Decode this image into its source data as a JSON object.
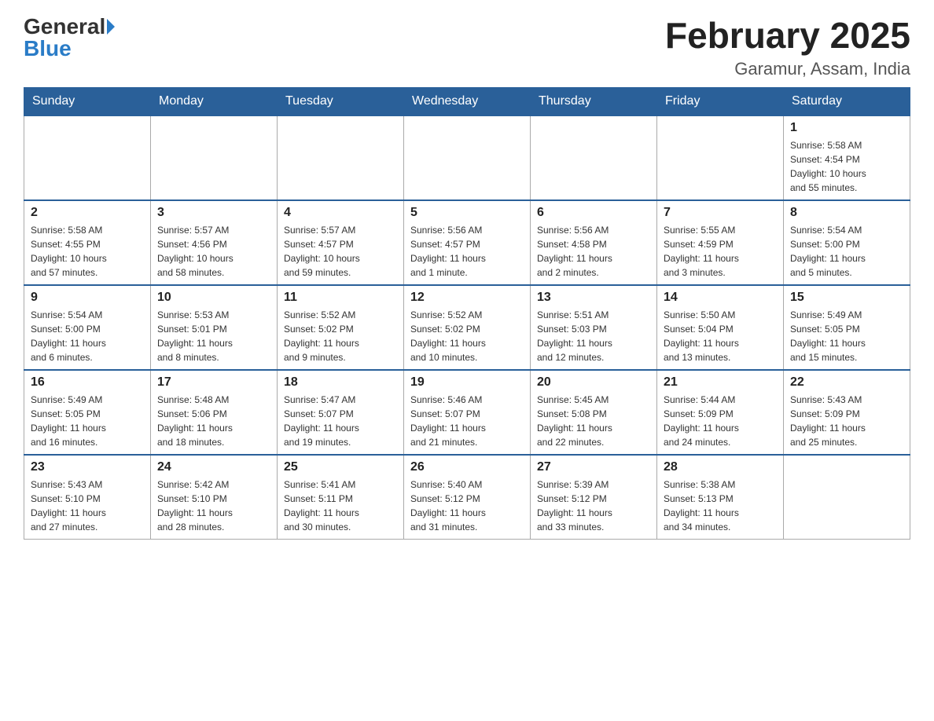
{
  "header": {
    "logo_general": "General",
    "logo_blue": "Blue",
    "title": "February 2025",
    "subtitle": "Garamur, Assam, India"
  },
  "weekdays": [
    "Sunday",
    "Monday",
    "Tuesday",
    "Wednesday",
    "Thursday",
    "Friday",
    "Saturday"
  ],
  "weeks": [
    [
      {
        "day": "",
        "info": ""
      },
      {
        "day": "",
        "info": ""
      },
      {
        "day": "",
        "info": ""
      },
      {
        "day": "",
        "info": ""
      },
      {
        "day": "",
        "info": ""
      },
      {
        "day": "",
        "info": ""
      },
      {
        "day": "1",
        "info": "Sunrise: 5:58 AM\nSunset: 4:54 PM\nDaylight: 10 hours\nand 55 minutes."
      }
    ],
    [
      {
        "day": "2",
        "info": "Sunrise: 5:58 AM\nSunset: 4:55 PM\nDaylight: 10 hours\nand 57 minutes."
      },
      {
        "day": "3",
        "info": "Sunrise: 5:57 AM\nSunset: 4:56 PM\nDaylight: 10 hours\nand 58 minutes."
      },
      {
        "day": "4",
        "info": "Sunrise: 5:57 AM\nSunset: 4:57 PM\nDaylight: 10 hours\nand 59 minutes."
      },
      {
        "day": "5",
        "info": "Sunrise: 5:56 AM\nSunset: 4:57 PM\nDaylight: 11 hours\nand 1 minute."
      },
      {
        "day": "6",
        "info": "Sunrise: 5:56 AM\nSunset: 4:58 PM\nDaylight: 11 hours\nand 2 minutes."
      },
      {
        "day": "7",
        "info": "Sunrise: 5:55 AM\nSunset: 4:59 PM\nDaylight: 11 hours\nand 3 minutes."
      },
      {
        "day": "8",
        "info": "Sunrise: 5:54 AM\nSunset: 5:00 PM\nDaylight: 11 hours\nand 5 minutes."
      }
    ],
    [
      {
        "day": "9",
        "info": "Sunrise: 5:54 AM\nSunset: 5:00 PM\nDaylight: 11 hours\nand 6 minutes."
      },
      {
        "day": "10",
        "info": "Sunrise: 5:53 AM\nSunset: 5:01 PM\nDaylight: 11 hours\nand 8 minutes."
      },
      {
        "day": "11",
        "info": "Sunrise: 5:52 AM\nSunset: 5:02 PM\nDaylight: 11 hours\nand 9 minutes."
      },
      {
        "day": "12",
        "info": "Sunrise: 5:52 AM\nSunset: 5:02 PM\nDaylight: 11 hours\nand 10 minutes."
      },
      {
        "day": "13",
        "info": "Sunrise: 5:51 AM\nSunset: 5:03 PM\nDaylight: 11 hours\nand 12 minutes."
      },
      {
        "day": "14",
        "info": "Sunrise: 5:50 AM\nSunset: 5:04 PM\nDaylight: 11 hours\nand 13 minutes."
      },
      {
        "day": "15",
        "info": "Sunrise: 5:49 AM\nSunset: 5:05 PM\nDaylight: 11 hours\nand 15 minutes."
      }
    ],
    [
      {
        "day": "16",
        "info": "Sunrise: 5:49 AM\nSunset: 5:05 PM\nDaylight: 11 hours\nand 16 minutes."
      },
      {
        "day": "17",
        "info": "Sunrise: 5:48 AM\nSunset: 5:06 PM\nDaylight: 11 hours\nand 18 minutes."
      },
      {
        "day": "18",
        "info": "Sunrise: 5:47 AM\nSunset: 5:07 PM\nDaylight: 11 hours\nand 19 minutes."
      },
      {
        "day": "19",
        "info": "Sunrise: 5:46 AM\nSunset: 5:07 PM\nDaylight: 11 hours\nand 21 minutes."
      },
      {
        "day": "20",
        "info": "Sunrise: 5:45 AM\nSunset: 5:08 PM\nDaylight: 11 hours\nand 22 minutes."
      },
      {
        "day": "21",
        "info": "Sunrise: 5:44 AM\nSunset: 5:09 PM\nDaylight: 11 hours\nand 24 minutes."
      },
      {
        "day": "22",
        "info": "Sunrise: 5:43 AM\nSunset: 5:09 PM\nDaylight: 11 hours\nand 25 minutes."
      }
    ],
    [
      {
        "day": "23",
        "info": "Sunrise: 5:43 AM\nSunset: 5:10 PM\nDaylight: 11 hours\nand 27 minutes."
      },
      {
        "day": "24",
        "info": "Sunrise: 5:42 AM\nSunset: 5:10 PM\nDaylight: 11 hours\nand 28 minutes."
      },
      {
        "day": "25",
        "info": "Sunrise: 5:41 AM\nSunset: 5:11 PM\nDaylight: 11 hours\nand 30 minutes."
      },
      {
        "day": "26",
        "info": "Sunrise: 5:40 AM\nSunset: 5:12 PM\nDaylight: 11 hours\nand 31 minutes."
      },
      {
        "day": "27",
        "info": "Sunrise: 5:39 AM\nSunset: 5:12 PM\nDaylight: 11 hours\nand 33 minutes."
      },
      {
        "day": "28",
        "info": "Sunrise: 5:38 AM\nSunset: 5:13 PM\nDaylight: 11 hours\nand 34 minutes."
      },
      {
        "day": "",
        "info": ""
      }
    ]
  ]
}
